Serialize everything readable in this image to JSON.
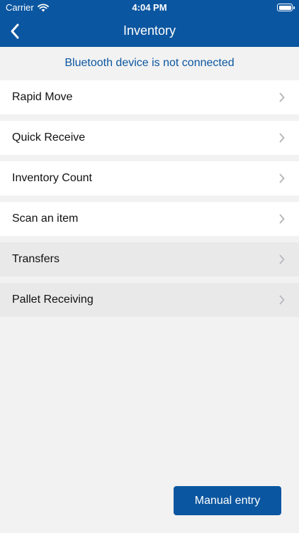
{
  "status": {
    "carrier": "Carrier",
    "time": "4:04 PM"
  },
  "nav": {
    "title": "Inventory"
  },
  "banner": {
    "text": "Bluetooth device is not connected"
  },
  "menu": {
    "items": [
      {
        "label": "Rapid Move"
      },
      {
        "label": "Quick Receive"
      },
      {
        "label": "Inventory Count"
      },
      {
        "label": "Scan an item"
      },
      {
        "label": "Transfers"
      },
      {
        "label": "Pallet Receiving"
      }
    ]
  },
  "actions": {
    "manual_entry": "Manual entry"
  },
  "colors": {
    "brand": "#0b56a0",
    "background": "#f2f2f2",
    "disabled_row": "#e9e9ea"
  }
}
